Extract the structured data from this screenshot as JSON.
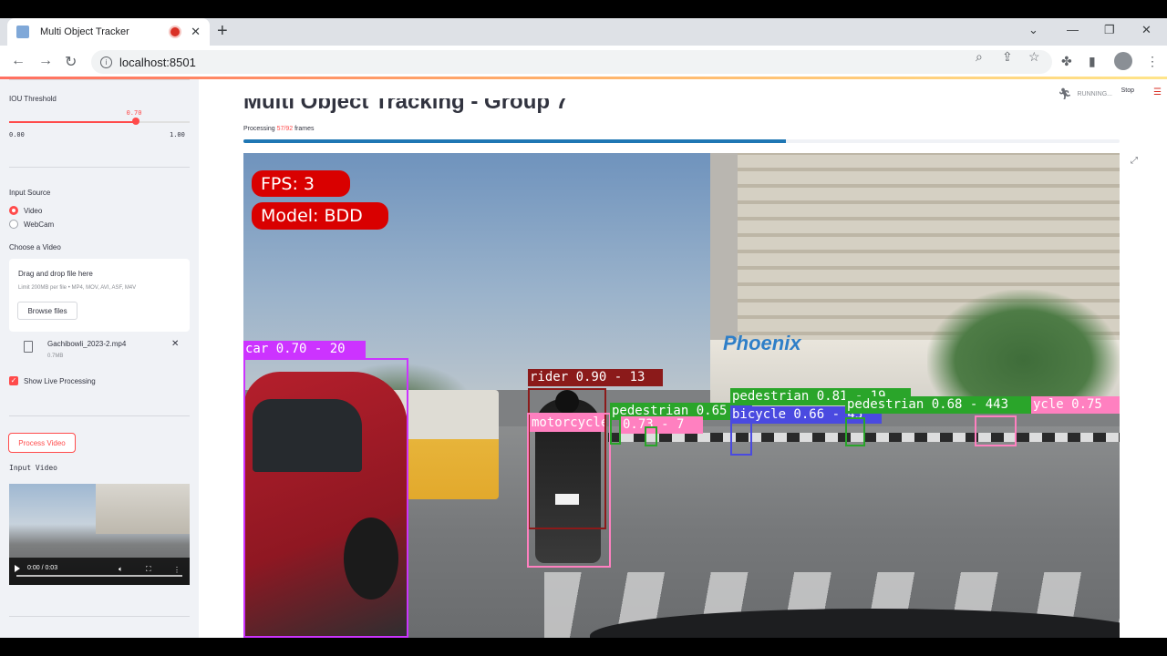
{
  "browser": {
    "tab_title": "Multi Object Tracker",
    "url": "localhost:8501"
  },
  "sidebar": {
    "iou_label": "IOU Threshold",
    "iou_value": "0.70",
    "iou_fraction": 0.7,
    "iou_min": "0.00",
    "iou_max": "1.00",
    "input_source_label": "Input Source",
    "input_options": [
      "Video",
      "WebCam"
    ],
    "input_selected": "Video",
    "choose_label": "Choose a Video",
    "drop_heading": "Drag and drop file here",
    "drop_limits": "Limit 200MB per file • MP4, MOV, AVI, ASF, M4V",
    "browse_label": "Browse files",
    "file_name": "Gachibowli_2023-2.mp4",
    "file_size": "0.7MB",
    "show_live_label": "Show Live Processing",
    "process_button": "Process Video",
    "input_video_label": "Input Video",
    "video_time": "0:00 / 0:03"
  },
  "main": {
    "title": "Multi Object Tracking - Group 7",
    "status": "RUNNING...",
    "stop_label": "Stop",
    "processing_prefix": "Processing",
    "processed_frames": "57",
    "total_frames": "92",
    "processing_suffix": "frames",
    "progress_fraction": 0.6196
  },
  "overlay": {
    "fps": "FPS: 3",
    "model": "Model: BDD",
    "detections": [
      {
        "label": "car 0.70 - 20",
        "color": "#cc33ff"
      },
      {
        "label": "rider 0.90 - 13",
        "color": "#8b1a1a"
      },
      {
        "label": "motorcycle",
        "color": "#ff80c0"
      },
      {
        "label": "pedestrian 0.65",
        "color": "#2aa52a"
      },
      {
        "label": "0.73 - 7",
        "color": "#ff80c0"
      },
      {
        "label": "pedestrian 0.81 - 19",
        "color": "#2aa52a"
      },
      {
        "label": "pedestrian 0.68 - 443",
        "color": "#2aa52a"
      },
      {
        "label": "bicycle 0.66 - 45",
        "color": "#4a4ae0"
      },
      {
        "label": "ycle 0.75",
        "color": "#ff80c0"
      }
    ],
    "logo_text": "Phoenix"
  }
}
